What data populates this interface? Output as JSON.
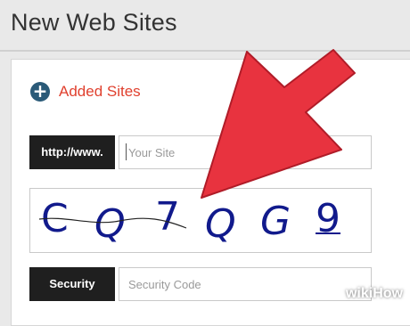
{
  "page": {
    "title": "New Web Sites"
  },
  "added_sites": {
    "icon": "plus-circle-icon",
    "label": "Added Sites"
  },
  "site_field": {
    "prefix": "http://www.",
    "placeholder": "Your Site",
    "value": ""
  },
  "captcha": {
    "characters": [
      "C",
      "Q",
      "7",
      "Q",
      "G",
      "9"
    ]
  },
  "security": {
    "label": "Security",
    "placeholder": "Security Code",
    "value": ""
  },
  "watermark": {
    "prefix": "wiki",
    "suffix": "How"
  },
  "colors": {
    "accent": "#e0402e",
    "arrow": "#e8333f",
    "captcha_text": "#111a8c",
    "plus_icon": "#2a5a78"
  }
}
